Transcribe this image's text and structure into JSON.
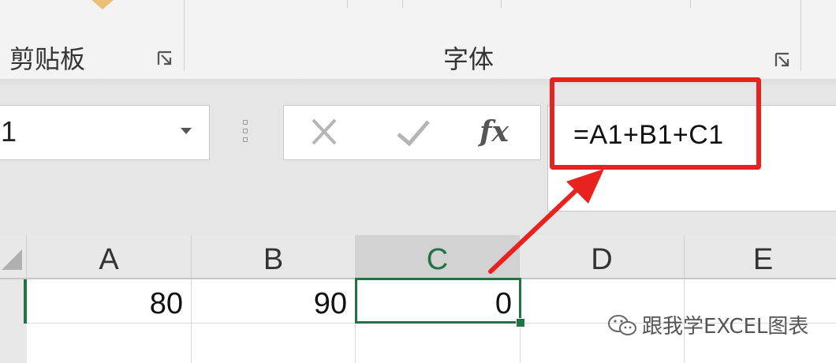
{
  "ribbon": {
    "groups": [
      {
        "label": "剪贴板",
        "launcher_icon": "dialog-launcher-icon"
      },
      {
        "label": "字体",
        "launcher_icon": "dialog-launcher-icon"
      }
    ],
    "paste_icon": "paste-brush-icon"
  },
  "formula_bar": {
    "name_box_value": "1",
    "cancel_icon": "cancel-x-icon",
    "enter_icon": "checkmark-icon",
    "fx_label": "fx",
    "formula": "=A1+B1+C1"
  },
  "sheet": {
    "columns": [
      "A",
      "B",
      "C",
      "D",
      "E"
    ],
    "selected_column": "C",
    "rows": [
      {
        "cells": [
          "80",
          "90",
          "0",
          "",
          ""
        ]
      }
    ],
    "active_cell": "C1"
  },
  "annotation": {
    "highlight_color": "#e8231f",
    "arrow_color": "#e8231f"
  },
  "watermark": {
    "text": "跟我学EXCEL图表",
    "icon": "wechat-icon"
  },
  "colors": {
    "excel_green": "#217346"
  }
}
